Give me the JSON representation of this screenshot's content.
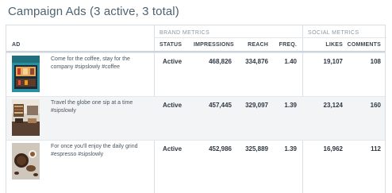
{
  "page": {
    "title": "Campaign Ads (3 active, 3 total)"
  },
  "table": {
    "group_brand": "BRAND METRICS",
    "group_social": "SOCIAL METRICS",
    "columns": {
      "ad": "AD",
      "status": "STATUS",
      "impressions": "IMPRESSIONS",
      "reach": "REACH",
      "freq": "FREQ.",
      "likes": "LIKES",
      "comments": "COMMENTS"
    },
    "rows": [
      {
        "text": "Come for the coffee, stay for the company #sipslowly #coffee",
        "status": "Active",
        "impressions": "468,826",
        "reach": "334,876",
        "freq": "1.40",
        "likes": "19,107",
        "comments": "108",
        "thumb": "storefront-photo"
      },
      {
        "text": "Travel the globe one sip at a time #sipslowly",
        "status": "Active",
        "impressions": "457,445",
        "reach": "329,097",
        "freq": "1.39",
        "likes": "23,124",
        "comments": "160",
        "thumb": "cafe-interior-photo"
      },
      {
        "text": "For once you'll enjoy the daily grind #espresso #sipslowly",
        "status": "Active",
        "impressions": "452,986",
        "reach": "325,889",
        "freq": "1.39",
        "likes": "16,962",
        "comments": "112",
        "thumb": "coffee-beans-photo"
      }
    ]
  },
  "colors": {
    "title": "#4e6270",
    "border": "#d6dde3",
    "shaded_row": "#f3f4f6",
    "group_label": "#8a98a5"
  }
}
